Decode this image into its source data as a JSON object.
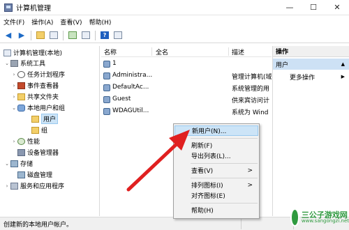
{
  "window": {
    "title": "计算机管理",
    "controls": {
      "minimize": "—",
      "maximize": "☐",
      "close": "✕"
    }
  },
  "menubar": [
    "文件(F)",
    "操作(A)",
    "查看(V)",
    "帮助(H)"
  ],
  "toolbar": {
    "back": "◀",
    "forward": "▶",
    "help": "?"
  },
  "tree": [
    {
      "label": "计算机管理(本地)",
      "icon": "computer-icon",
      "expand": ""
    },
    {
      "label": "系统工具",
      "icon": "tools-icon",
      "expand": "⌄"
    },
    {
      "label": "任务计划程序",
      "icon": "clock-icon",
      "expand": "›"
    },
    {
      "label": "事件查看器",
      "icon": "event-viewer-icon",
      "expand": "›"
    },
    {
      "label": "共享文件夹",
      "icon": "shared-folder-icon",
      "expand": "›"
    },
    {
      "label": "本地用户和组",
      "icon": "users-icon",
      "expand": "⌄"
    },
    {
      "label": "用户",
      "icon": "folder-icon",
      "expand": ""
    },
    {
      "label": "组",
      "icon": "folder-icon",
      "expand": ""
    },
    {
      "label": "性能",
      "icon": "performance-icon",
      "expand": "›"
    },
    {
      "label": "设备管理器",
      "icon": "device-manager-icon",
      "expand": ""
    },
    {
      "label": "存储",
      "icon": "storage-icon",
      "expand": "⌄"
    },
    {
      "label": "磁盘管理",
      "icon": "disk-icon",
      "expand": ""
    },
    {
      "label": "服务和应用程序",
      "icon": "services-icon",
      "expand": "›"
    }
  ],
  "list": {
    "columns": {
      "name": "名称",
      "fullname": "全名",
      "desc": "描述"
    },
    "rows": [
      {
        "name": "1",
        "desc": ""
      },
      {
        "name": "Administra...",
        "desc": "管理计算机(域"
      },
      {
        "name": "DefaultAc...",
        "desc": "系统管理的用"
      },
      {
        "name": "Guest",
        "desc": "供来宾访问计"
      },
      {
        "name": "WDAGUtil...",
        "desc": "系统为 Wind"
      }
    ]
  },
  "actions": {
    "header": "操作",
    "section": "用户",
    "more": "更多操作",
    "arrow_up": "▲",
    "arrow_right": "▶"
  },
  "context_menu": {
    "new_user": "新用户(N)...",
    "refresh": "刷新(F)",
    "export": "导出列表(L)...",
    "view": "查看(V)",
    "arrange": "排列图标(I)",
    "align": "对齐图标(E)",
    "help": "帮助(H)",
    "submenu_arrow": ">"
  },
  "statusbar": {
    "text": "创建新的本地用户帐户。"
  },
  "watermark": {
    "name": "三公子游戏网",
    "url": "www.sangongzi.net"
  },
  "colors": {
    "arrow": "#e02020",
    "selection": "#cce4f7",
    "watermark": "#2f9a3f"
  }
}
